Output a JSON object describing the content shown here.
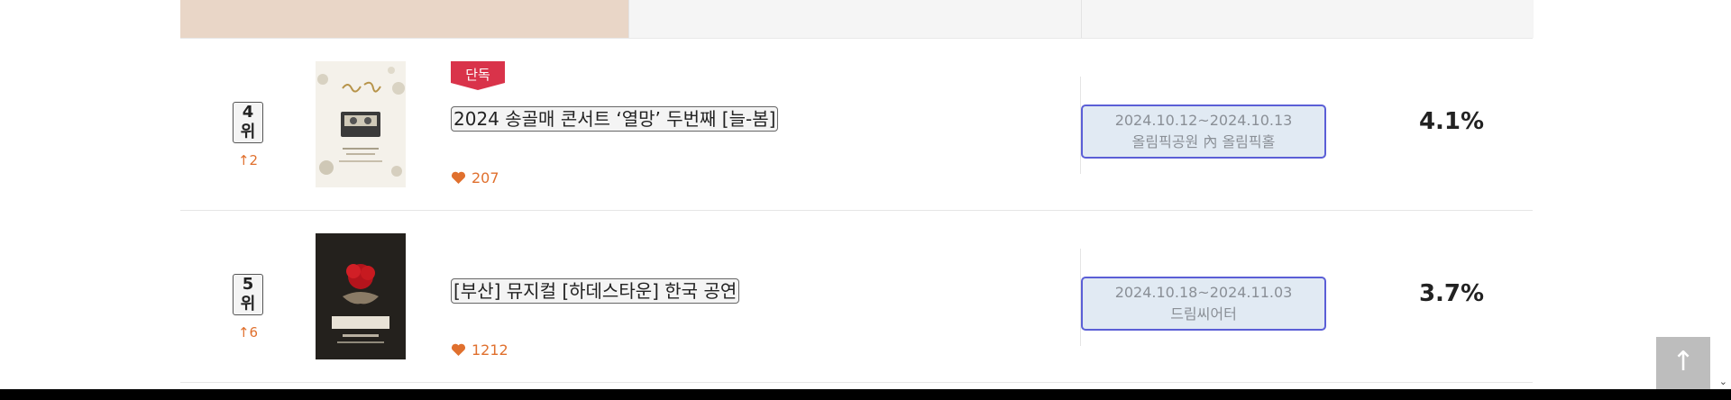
{
  "ranking": [
    {
      "rank_label": "4위",
      "rank_change": "↑2",
      "badge": "단독",
      "title": "2024 송골매 콘서트 ‘열망’ 두번째 [늘-봄]",
      "likes": "207",
      "date": "2024.10.12~2024.10.13",
      "venue": "올림픽공원 內 올림픽홀",
      "share": "4.1%"
    },
    {
      "rank_label": "5위",
      "rank_change": "↑6",
      "title": "[부산] 뮤지컬 [하데스타운] 한국 공연",
      "likes": "1212",
      "date": "2024.10.18~2024.11.03",
      "venue": "드림씨어터",
      "share": "3.7%"
    }
  ],
  "scroll_top_button": "↑",
  "scrollbar_arrow": "⌄",
  "poster_lettering": {
    "row1_script": "늘봄",
    "row2_wordmark": "HADESTOWN"
  },
  "colors": {
    "accent_orange": "#e0702e",
    "badge_red": "#d9334a",
    "info_border": "#5b5fd6",
    "info_bg": "#e1eaf3"
  }
}
